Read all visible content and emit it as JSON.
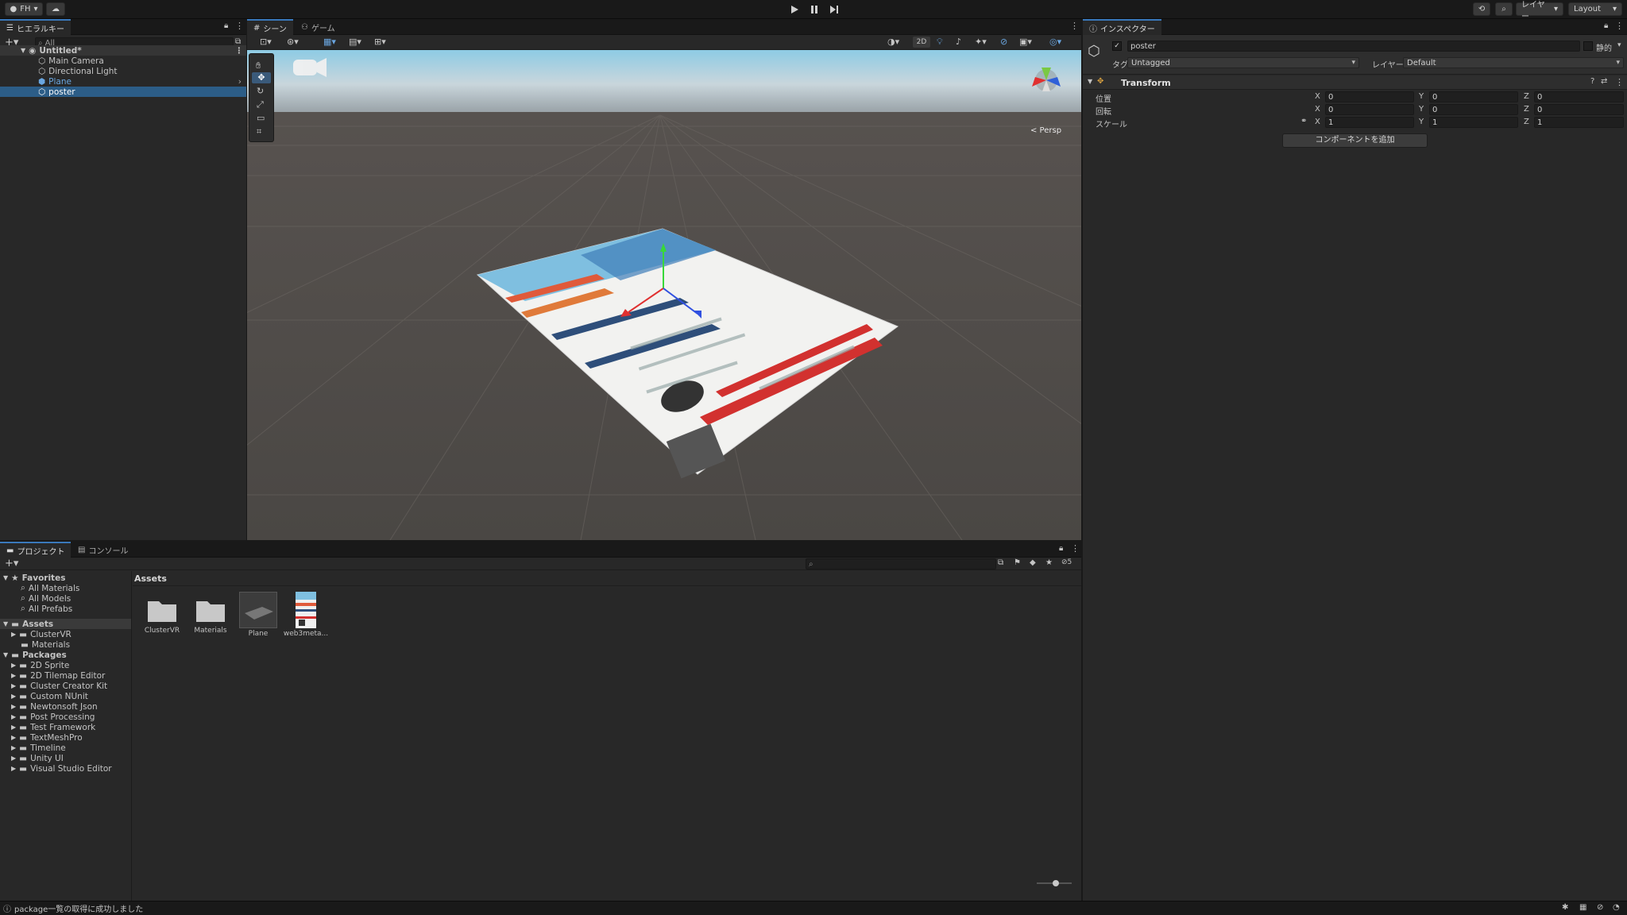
{
  "topbar": {
    "account": "FH",
    "undo_history": "",
    "layers": "レイヤー",
    "layout": "Layout"
  },
  "hierarchy": {
    "tab": "ヒエラルキー",
    "search_placeholder": "All",
    "scene": "Untitled*",
    "items": [
      {
        "label": "Main Camera"
      },
      {
        "label": "Directional Light"
      },
      {
        "label": "Plane"
      },
      {
        "label": "poster"
      }
    ]
  },
  "scene_view": {
    "tabs": [
      "シーン",
      "ゲーム"
    ],
    "toggle_2d": "2D",
    "persp_label": "< Persp"
  },
  "inspector": {
    "tab": "インスペクター",
    "object_name": "poster",
    "static_label": "静的",
    "tag_label": "タグ",
    "tag_value": "Untagged",
    "layer_label": "レイヤー",
    "layer_value": "Default",
    "transform_title": "Transform",
    "rows": [
      {
        "label": "位置",
        "x": "0",
        "y": "0",
        "z": "0"
      },
      {
        "label": "回転",
        "x": "0",
        "y": "0",
        "z": "0"
      },
      {
        "label": "スケール",
        "x": "1",
        "y": "1",
        "z": "1"
      }
    ],
    "add_component": "コンポーネントを追加"
  },
  "project": {
    "tabs": [
      "プロジェクト",
      "コンソール"
    ],
    "favorites_label": "Favorites",
    "favorites": [
      "All Materials",
      "All Models",
      "All Prefabs"
    ],
    "assets_label": "Assets",
    "assets_children": [
      "ClusterVR",
      "Materials"
    ],
    "packages_label": "Packages",
    "packages": [
      "2D Sprite",
      "2D Tilemap Editor",
      "Cluster Creator Kit",
      "Custom NUnit",
      "Newtonsoft Json",
      "Post Processing",
      "Test Framework",
      "TextMeshPro",
      "Timeline",
      "Unity UI",
      "Visual Studio Editor"
    ],
    "breadcrumb": "Assets",
    "grid_items": [
      "ClusterVR",
      "Materials",
      "Plane",
      "web3meta..."
    ],
    "hidden_count": "5"
  },
  "status": {
    "message": "package一覧の取得に成功しました"
  }
}
